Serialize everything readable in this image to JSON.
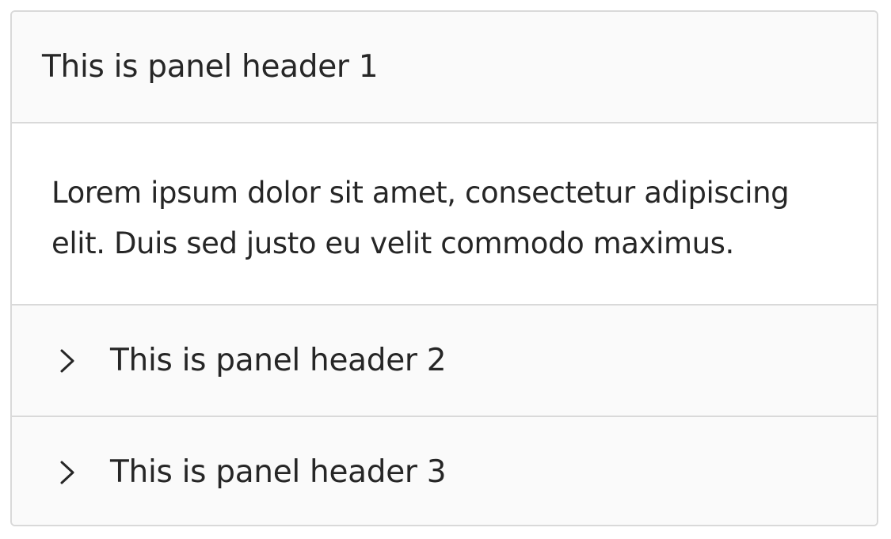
{
  "panels": [
    {
      "header": "This is panel header 1",
      "expanded": true,
      "content": "Lorem ipsum dolor sit amet, consectetur adipiscing elit. Duis sed justo eu velit commodo maximus."
    },
    {
      "header": "This is panel header 2",
      "expanded": false,
      "icon": "chevron-right-icon"
    },
    {
      "header": "This is panel header 3",
      "expanded": false,
      "icon": "chevron-right-icon"
    }
  ],
  "colors": {
    "text": "#262626",
    "border": "#d9d9d9",
    "header_bg": "#fafafa",
    "content_bg": "#ffffff"
  }
}
